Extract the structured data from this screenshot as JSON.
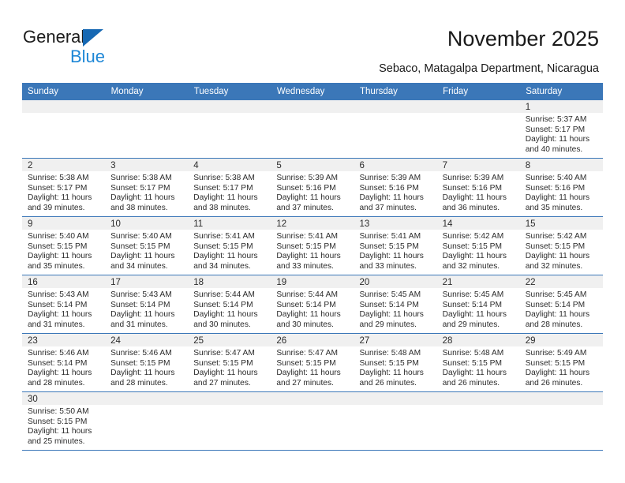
{
  "brand": {
    "name_part1": "General",
    "name_part2": "Blue",
    "logo_icon": "triangle-icon"
  },
  "header": {
    "title": "November 2025",
    "subtitle": "Sebaco, Matagalpa Department, Nicaragua"
  },
  "colors": {
    "header_blue": "#3b77b8",
    "logo_blue": "#1e87d6",
    "daynum_band": "#f0f0f0"
  },
  "weekdays": [
    "Sunday",
    "Monday",
    "Tuesday",
    "Wednesday",
    "Thursday",
    "Friday",
    "Saturday"
  ],
  "weeks": [
    [
      {
        "day": "",
        "empty": true
      },
      {
        "day": "",
        "empty": true
      },
      {
        "day": "",
        "empty": true
      },
      {
        "day": "",
        "empty": true
      },
      {
        "day": "",
        "empty": true
      },
      {
        "day": "",
        "empty": true
      },
      {
        "day": "1",
        "sunrise": "Sunrise: 5:37 AM",
        "sunset": "Sunset: 5:17 PM",
        "daylight1": "Daylight: 11 hours",
        "daylight2": "and 40 minutes."
      }
    ],
    [
      {
        "day": "2",
        "sunrise": "Sunrise: 5:38 AM",
        "sunset": "Sunset: 5:17 PM",
        "daylight1": "Daylight: 11 hours",
        "daylight2": "and 39 minutes."
      },
      {
        "day": "3",
        "sunrise": "Sunrise: 5:38 AM",
        "sunset": "Sunset: 5:17 PM",
        "daylight1": "Daylight: 11 hours",
        "daylight2": "and 38 minutes."
      },
      {
        "day": "4",
        "sunrise": "Sunrise: 5:38 AM",
        "sunset": "Sunset: 5:17 PM",
        "daylight1": "Daylight: 11 hours",
        "daylight2": "and 38 minutes."
      },
      {
        "day": "5",
        "sunrise": "Sunrise: 5:39 AM",
        "sunset": "Sunset: 5:16 PM",
        "daylight1": "Daylight: 11 hours",
        "daylight2": "and 37 minutes."
      },
      {
        "day": "6",
        "sunrise": "Sunrise: 5:39 AM",
        "sunset": "Sunset: 5:16 PM",
        "daylight1": "Daylight: 11 hours",
        "daylight2": "and 37 minutes."
      },
      {
        "day": "7",
        "sunrise": "Sunrise: 5:39 AM",
        "sunset": "Sunset: 5:16 PM",
        "daylight1": "Daylight: 11 hours",
        "daylight2": "and 36 minutes."
      },
      {
        "day": "8",
        "sunrise": "Sunrise: 5:40 AM",
        "sunset": "Sunset: 5:16 PM",
        "daylight1": "Daylight: 11 hours",
        "daylight2": "and 35 minutes."
      }
    ],
    [
      {
        "day": "9",
        "sunrise": "Sunrise: 5:40 AM",
        "sunset": "Sunset: 5:15 PM",
        "daylight1": "Daylight: 11 hours",
        "daylight2": "and 35 minutes."
      },
      {
        "day": "10",
        "sunrise": "Sunrise: 5:40 AM",
        "sunset": "Sunset: 5:15 PM",
        "daylight1": "Daylight: 11 hours",
        "daylight2": "and 34 minutes."
      },
      {
        "day": "11",
        "sunrise": "Sunrise: 5:41 AM",
        "sunset": "Sunset: 5:15 PM",
        "daylight1": "Daylight: 11 hours",
        "daylight2": "and 34 minutes."
      },
      {
        "day": "12",
        "sunrise": "Sunrise: 5:41 AM",
        "sunset": "Sunset: 5:15 PM",
        "daylight1": "Daylight: 11 hours",
        "daylight2": "and 33 minutes."
      },
      {
        "day": "13",
        "sunrise": "Sunrise: 5:41 AM",
        "sunset": "Sunset: 5:15 PM",
        "daylight1": "Daylight: 11 hours",
        "daylight2": "and 33 minutes."
      },
      {
        "day": "14",
        "sunrise": "Sunrise: 5:42 AM",
        "sunset": "Sunset: 5:15 PM",
        "daylight1": "Daylight: 11 hours",
        "daylight2": "and 32 minutes."
      },
      {
        "day": "15",
        "sunrise": "Sunrise: 5:42 AM",
        "sunset": "Sunset: 5:15 PM",
        "daylight1": "Daylight: 11 hours",
        "daylight2": "and 32 minutes."
      }
    ],
    [
      {
        "day": "16",
        "sunrise": "Sunrise: 5:43 AM",
        "sunset": "Sunset: 5:14 PM",
        "daylight1": "Daylight: 11 hours",
        "daylight2": "and 31 minutes."
      },
      {
        "day": "17",
        "sunrise": "Sunrise: 5:43 AM",
        "sunset": "Sunset: 5:14 PM",
        "daylight1": "Daylight: 11 hours",
        "daylight2": "and 31 minutes."
      },
      {
        "day": "18",
        "sunrise": "Sunrise: 5:44 AM",
        "sunset": "Sunset: 5:14 PM",
        "daylight1": "Daylight: 11 hours",
        "daylight2": "and 30 minutes."
      },
      {
        "day": "19",
        "sunrise": "Sunrise: 5:44 AM",
        "sunset": "Sunset: 5:14 PM",
        "daylight1": "Daylight: 11 hours",
        "daylight2": "and 30 minutes."
      },
      {
        "day": "20",
        "sunrise": "Sunrise: 5:45 AM",
        "sunset": "Sunset: 5:14 PM",
        "daylight1": "Daylight: 11 hours",
        "daylight2": "and 29 minutes."
      },
      {
        "day": "21",
        "sunrise": "Sunrise: 5:45 AM",
        "sunset": "Sunset: 5:14 PM",
        "daylight1": "Daylight: 11 hours",
        "daylight2": "and 29 minutes."
      },
      {
        "day": "22",
        "sunrise": "Sunrise: 5:45 AM",
        "sunset": "Sunset: 5:14 PM",
        "daylight1": "Daylight: 11 hours",
        "daylight2": "and 28 minutes."
      }
    ],
    [
      {
        "day": "23",
        "sunrise": "Sunrise: 5:46 AM",
        "sunset": "Sunset: 5:14 PM",
        "daylight1": "Daylight: 11 hours",
        "daylight2": "and 28 minutes."
      },
      {
        "day": "24",
        "sunrise": "Sunrise: 5:46 AM",
        "sunset": "Sunset: 5:15 PM",
        "daylight1": "Daylight: 11 hours",
        "daylight2": "and 28 minutes."
      },
      {
        "day": "25",
        "sunrise": "Sunrise: 5:47 AM",
        "sunset": "Sunset: 5:15 PM",
        "daylight1": "Daylight: 11 hours",
        "daylight2": "and 27 minutes."
      },
      {
        "day": "26",
        "sunrise": "Sunrise: 5:47 AM",
        "sunset": "Sunset: 5:15 PM",
        "daylight1": "Daylight: 11 hours",
        "daylight2": "and 27 minutes."
      },
      {
        "day": "27",
        "sunrise": "Sunrise: 5:48 AM",
        "sunset": "Sunset: 5:15 PM",
        "daylight1": "Daylight: 11 hours",
        "daylight2": "and 26 minutes."
      },
      {
        "day": "28",
        "sunrise": "Sunrise: 5:48 AM",
        "sunset": "Sunset: 5:15 PM",
        "daylight1": "Daylight: 11 hours",
        "daylight2": "and 26 minutes."
      },
      {
        "day": "29",
        "sunrise": "Sunrise: 5:49 AM",
        "sunset": "Sunset: 5:15 PM",
        "daylight1": "Daylight: 11 hours",
        "daylight2": "and 26 minutes."
      }
    ],
    [
      {
        "day": "30",
        "sunrise": "Sunrise: 5:50 AM",
        "sunset": "Sunset: 5:15 PM",
        "daylight1": "Daylight: 11 hours",
        "daylight2": "and 25 minutes."
      },
      {
        "day": "",
        "empty": true
      },
      {
        "day": "",
        "empty": true
      },
      {
        "day": "",
        "empty": true
      },
      {
        "day": "",
        "empty": true
      },
      {
        "day": "",
        "empty": true
      },
      {
        "day": "",
        "empty": true
      }
    ]
  ]
}
